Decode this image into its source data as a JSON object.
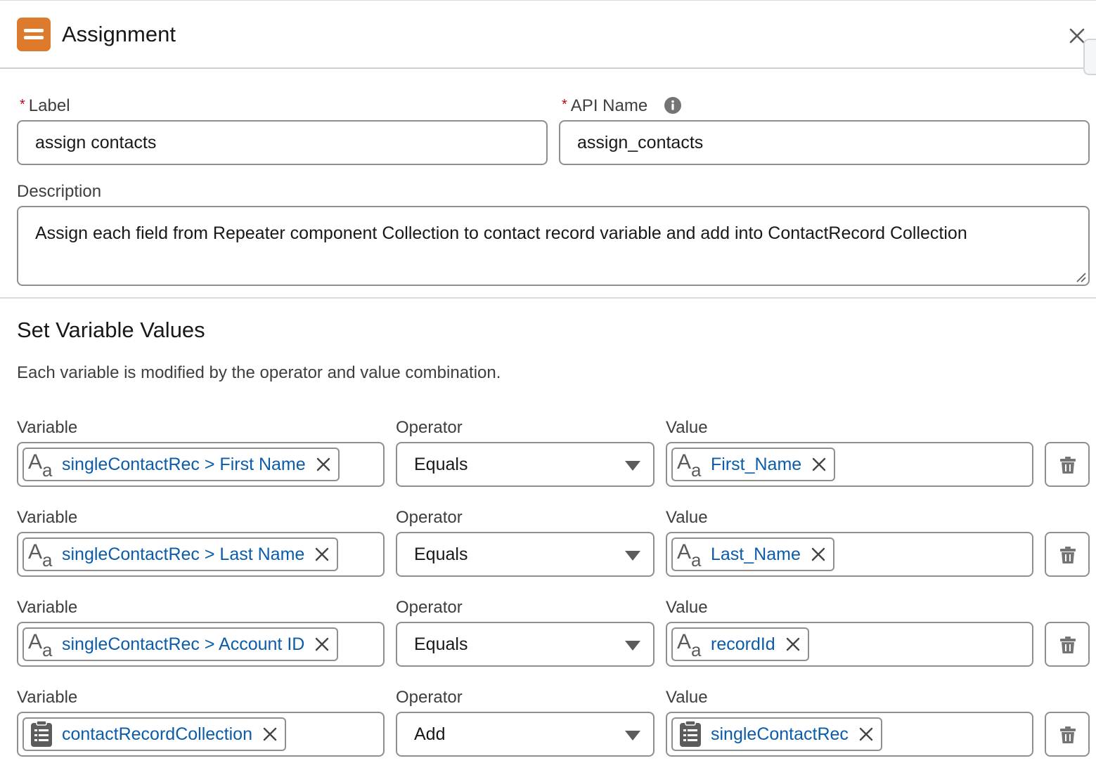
{
  "header": {
    "title": "Assignment",
    "icon": "assignment-icon",
    "accent": "#dd7a2b"
  },
  "form": {
    "label": {
      "title": "Label",
      "required_mark": "*",
      "value": "assign contacts"
    },
    "api_name": {
      "title": "API Name",
      "required_mark": "*",
      "value": "assign_contacts"
    },
    "description": {
      "title": "Description",
      "value": "Assign each field from Repeater component Collection to contact record variable and add into ContactRecord Collection"
    }
  },
  "section": {
    "title": "Set Variable Values",
    "subtitle": "Each variable is modified by the operator and value combination."
  },
  "column_labels": {
    "variable": "Variable",
    "operator": "Operator",
    "value": "Value"
  },
  "rows": [
    {
      "variable": "singleContactRec > First Name",
      "variable_icon": "text-type-icon",
      "operator": "Equals",
      "value": "First_Name",
      "value_icon": "text-type-icon"
    },
    {
      "variable": "singleContactRec > Last Name",
      "variable_icon": "text-type-icon",
      "operator": "Equals",
      "value": "Last_Name",
      "value_icon": "text-type-icon"
    },
    {
      "variable": "singleContactRec > Account ID",
      "variable_icon": "text-type-icon",
      "operator": "Equals",
      "value": "recordId",
      "value_icon": "text-type-icon"
    },
    {
      "variable": "contactRecordCollection",
      "variable_icon": "collection-icon",
      "operator": "Add",
      "value": "singleContactRec",
      "value_icon": "collection-icon"
    }
  ],
  "colors": {
    "link": "#0b5cab",
    "required": "#ba0517",
    "border": "#8f8f8f"
  }
}
